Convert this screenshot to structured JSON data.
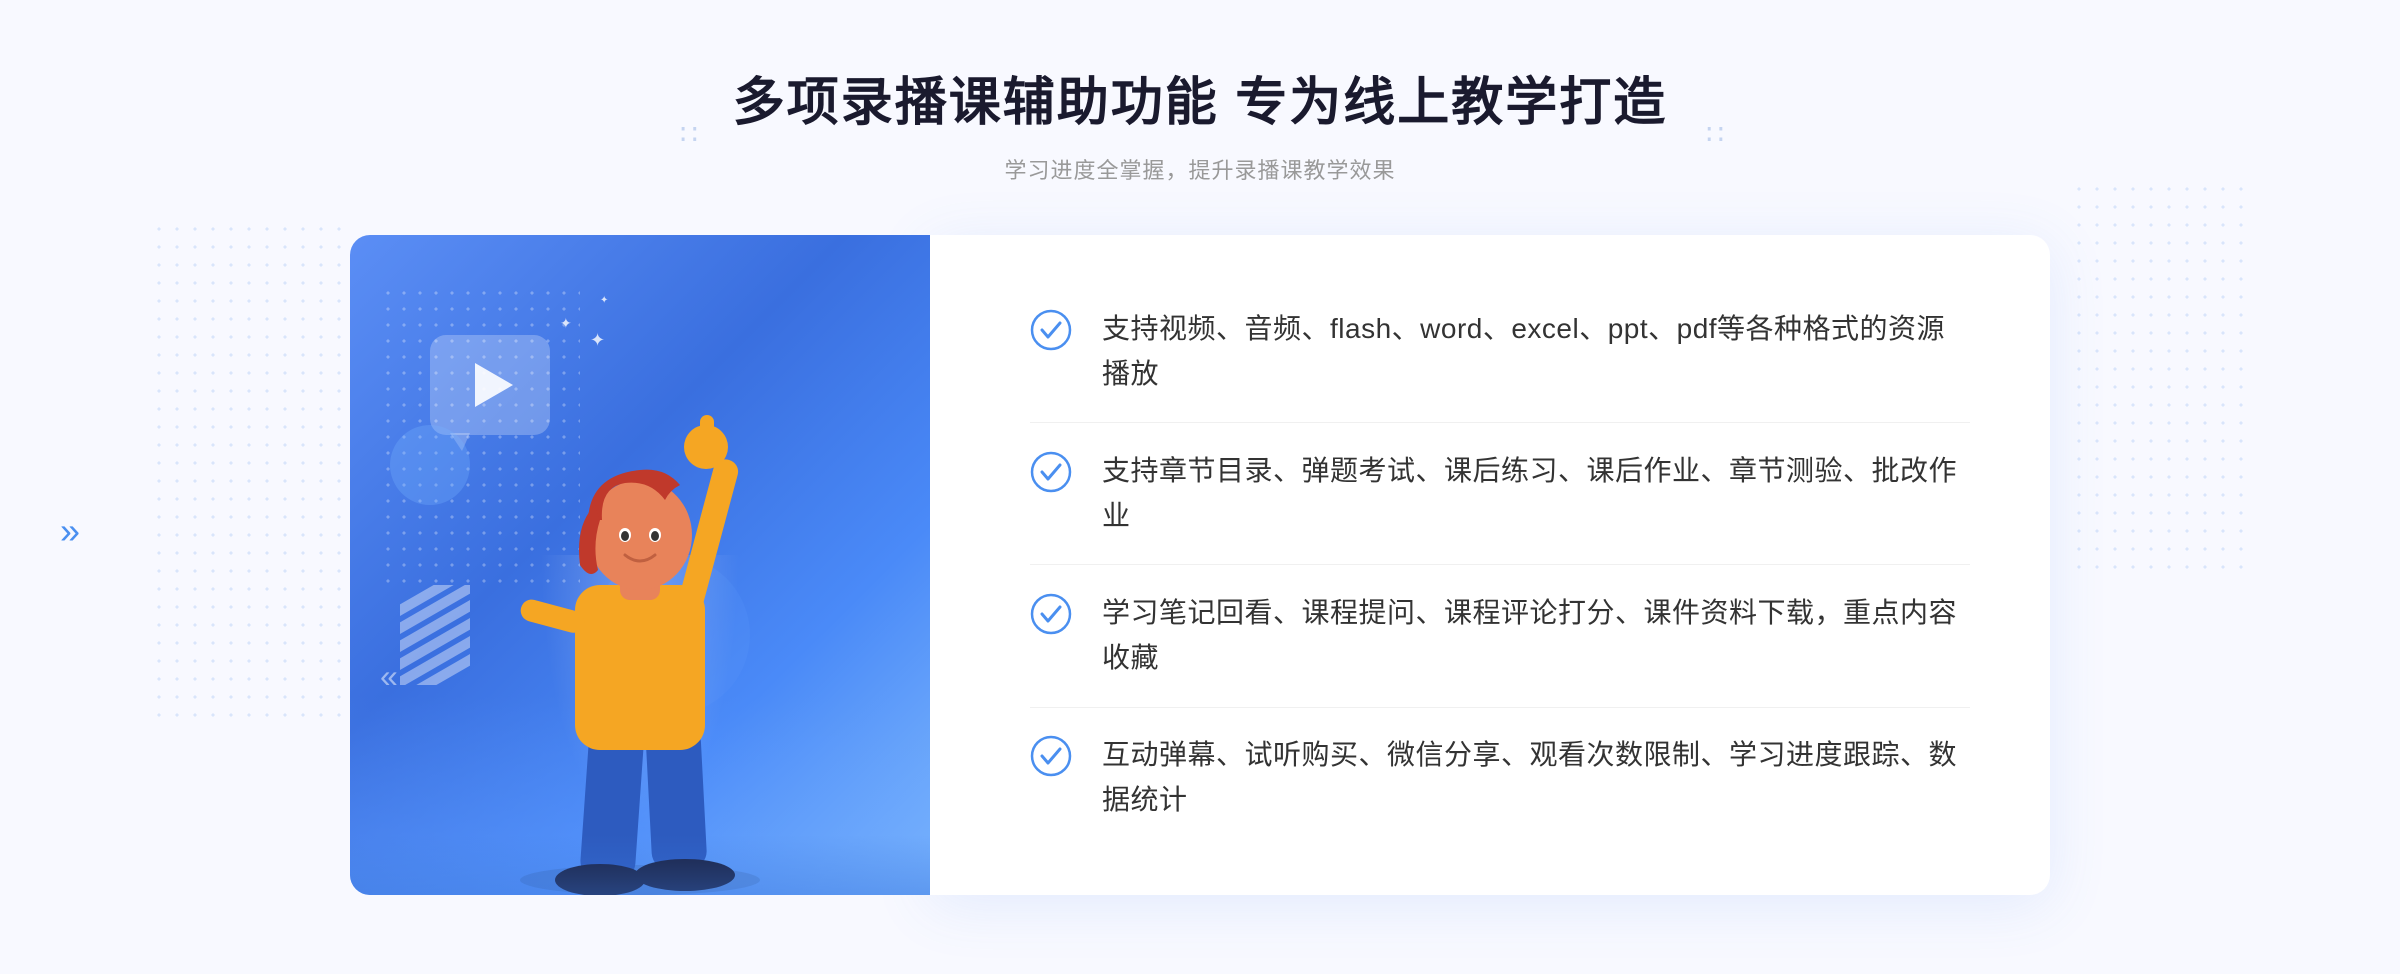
{
  "page": {
    "background": "#f8f9ff"
  },
  "header": {
    "title": "多项录播课辅助功能 专为线上教学打造",
    "subtitle": "学习进度全掌握，提升录播课教学效果",
    "chevron_left": "∷",
    "chevron_right": "∷"
  },
  "features": [
    {
      "id": 1,
      "text": "支持视频、音频、flash、word、excel、ppt、pdf等各种格式的资源播放"
    },
    {
      "id": 2,
      "text": "支持章节目录、弹题考试、课后练习、课后作业、章节测验、批改作业"
    },
    {
      "id": 3,
      "text": "学习笔记回看、课程提问、课程评论打分、课件资料下载，重点内容收藏"
    },
    {
      "id": 4,
      "text": "互动弹幕、试听购买、微信分享、观看次数限制、学习进度跟踪、数据统计"
    }
  ],
  "illustration": {
    "play_button_label": "▶",
    "gradient_start": "#5b8ef5",
    "gradient_end": "#7eb8fc"
  },
  "decorations": {
    "chevron_body_left": "»"
  }
}
